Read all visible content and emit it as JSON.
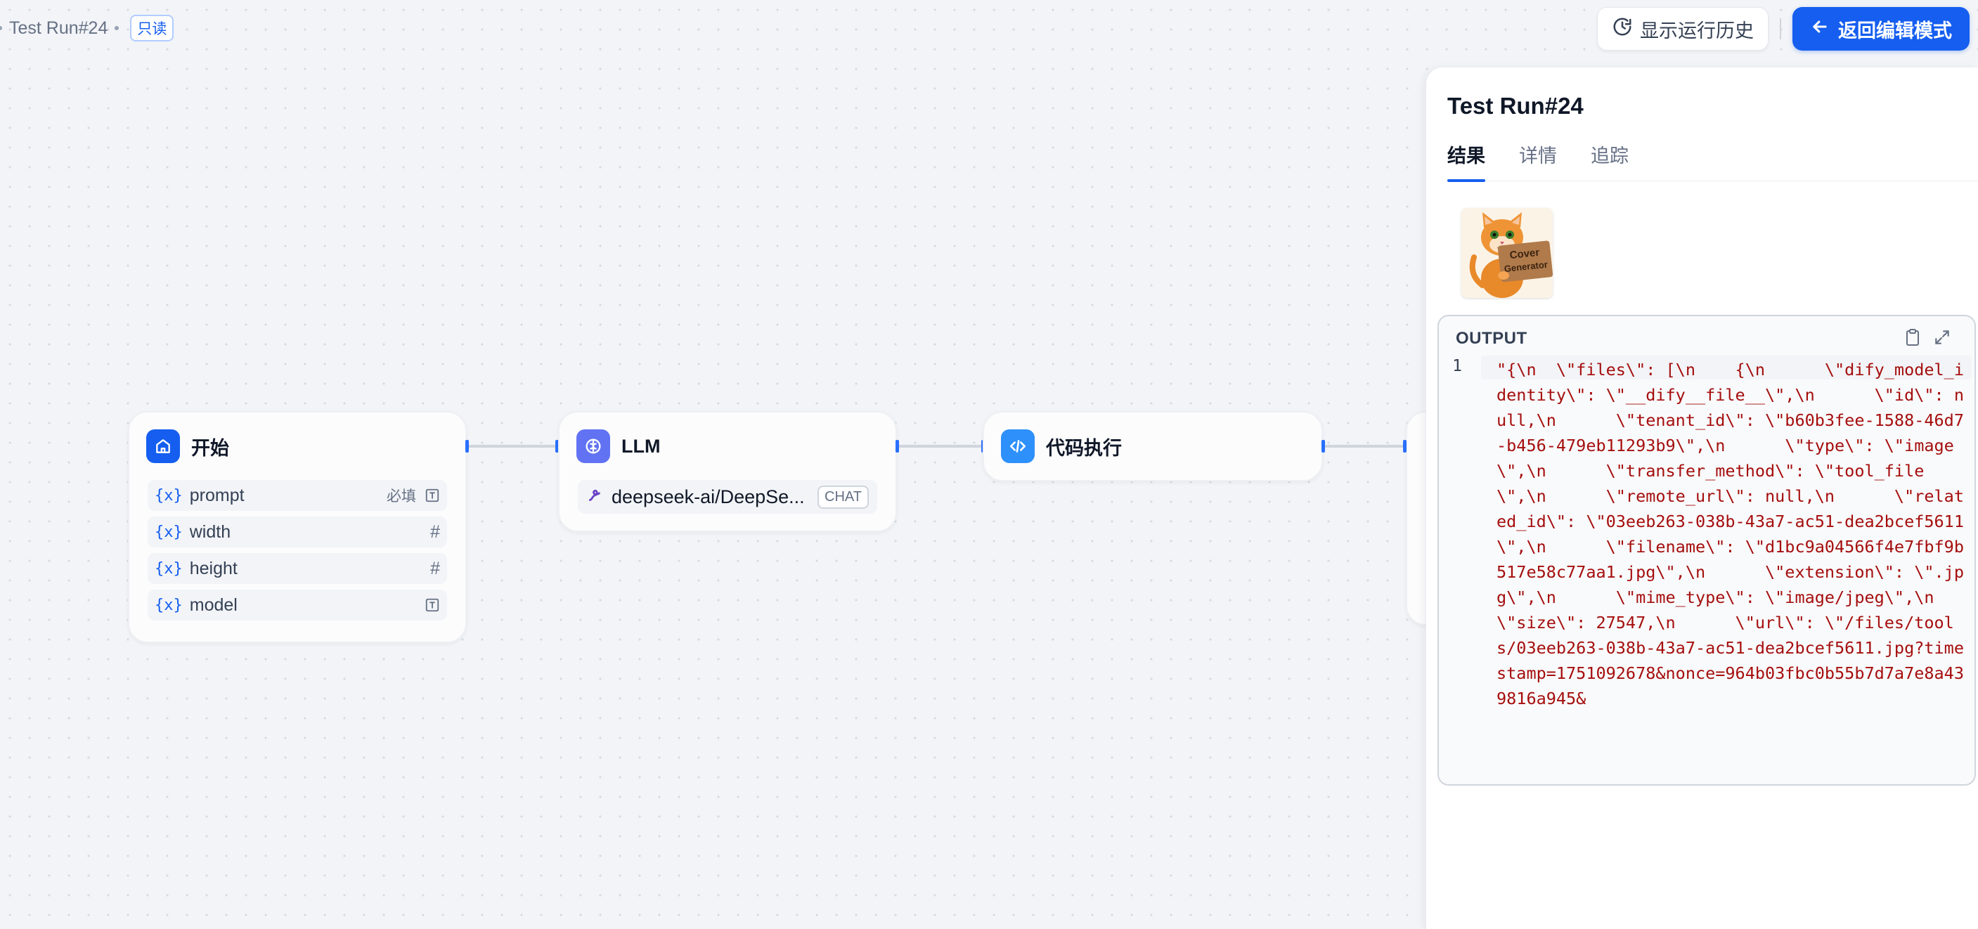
{
  "header": {
    "run_title": "Test Run#24",
    "read_only_badge": "只读",
    "history_button": "显示运行历史",
    "back_button": "返回编辑模式"
  },
  "nodes": {
    "start": {
      "title": "开始",
      "variables": [
        {
          "name": "prompt",
          "required": "必填",
          "type_icon": "text-icon"
        },
        {
          "name": "width",
          "required": "",
          "type_icon": "hash-icon",
          "type_glyph": "#"
        },
        {
          "name": "height",
          "required": "",
          "type_icon": "hash-icon",
          "type_glyph": "#"
        },
        {
          "name": "model",
          "required": "",
          "type_icon": "text-icon"
        }
      ],
      "var_prefix": "{x}"
    },
    "llm": {
      "title": "LLM",
      "model": "deepseek-ai/DeepSe...",
      "mode_tag": "CHAT"
    },
    "code": {
      "title": "代码执行"
    }
  },
  "panel": {
    "title": "Test Run#24",
    "tabs": [
      "结果",
      "详情",
      "追踪"
    ],
    "active_tab": "结果",
    "thumbnail_text": "Cover Generator",
    "output_label": "OUTPUT",
    "line_number": "1",
    "output_code": "\"{\\n  \\\"files\\\": [\\n    {\\n      \\\"dify_model_identity\\\": \\\"__dify__file__\\\",\\n      \\\"id\\\": null,\\n      \\\"tenant_id\\\": \\\"b60b3fee-1588-46d7-b456-479eb11293b9\\\",\\n      \\\"type\\\": \\\"image\\\",\\n      \\\"transfer_method\\\": \\\"tool_file\\\",\\n      \\\"remote_url\\\": null,\\n      \\\"related_id\\\": \\\"03eeb263-038b-43a7-ac51-dea2bcef5611\\\",\\n      \\\"filename\\\": \\\"d1bc9a04566f4e7fbf9b517e58c77aa1.jpg\\\",\\n      \\\"extension\\\": \\\".jpg\\\",\\n      \\\"mime_type\\\": \\\"image/jpeg\\\",\\n      \\\"size\\\": 27547,\\n      \\\"url\\\": \\\"/files/tools/03eeb263-038b-43a7-ac51-dea2bcef5611.jpg?timestamp=1751092678&nonce=964b03fbc0b55b7d7a7e8a439816a945&"
  },
  "colors": {
    "primary": "#155eef",
    "canvas": "#f2f4f7",
    "code_text": "#a50e0e"
  }
}
